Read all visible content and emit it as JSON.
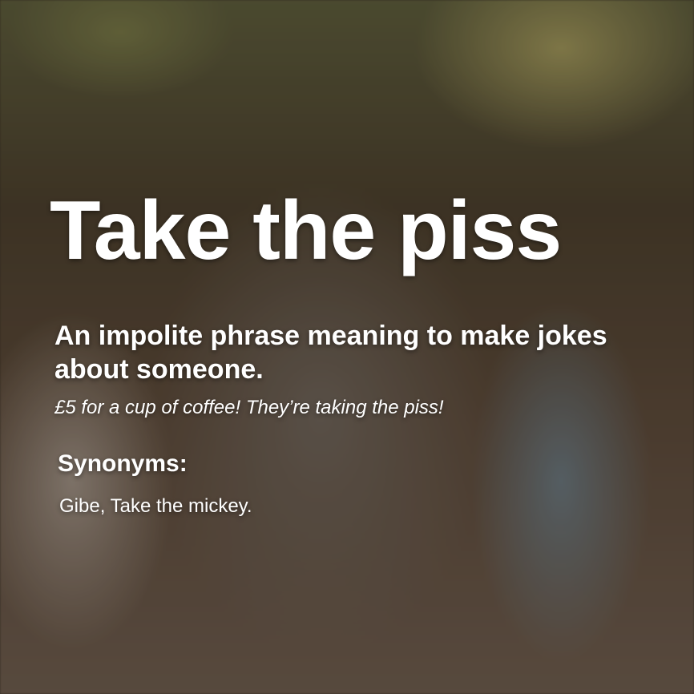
{
  "card": {
    "title": "Take the piss",
    "definition": "An impolite phrase meaning to make jokes about someone.",
    "example": "£5 for a cup of coffee! They’re taking the piss!",
    "synonyms_heading": "Synonyms:",
    "synonyms": "Gibe, Take the mickey."
  },
  "colors": {
    "text": "#ffffff"
  }
}
